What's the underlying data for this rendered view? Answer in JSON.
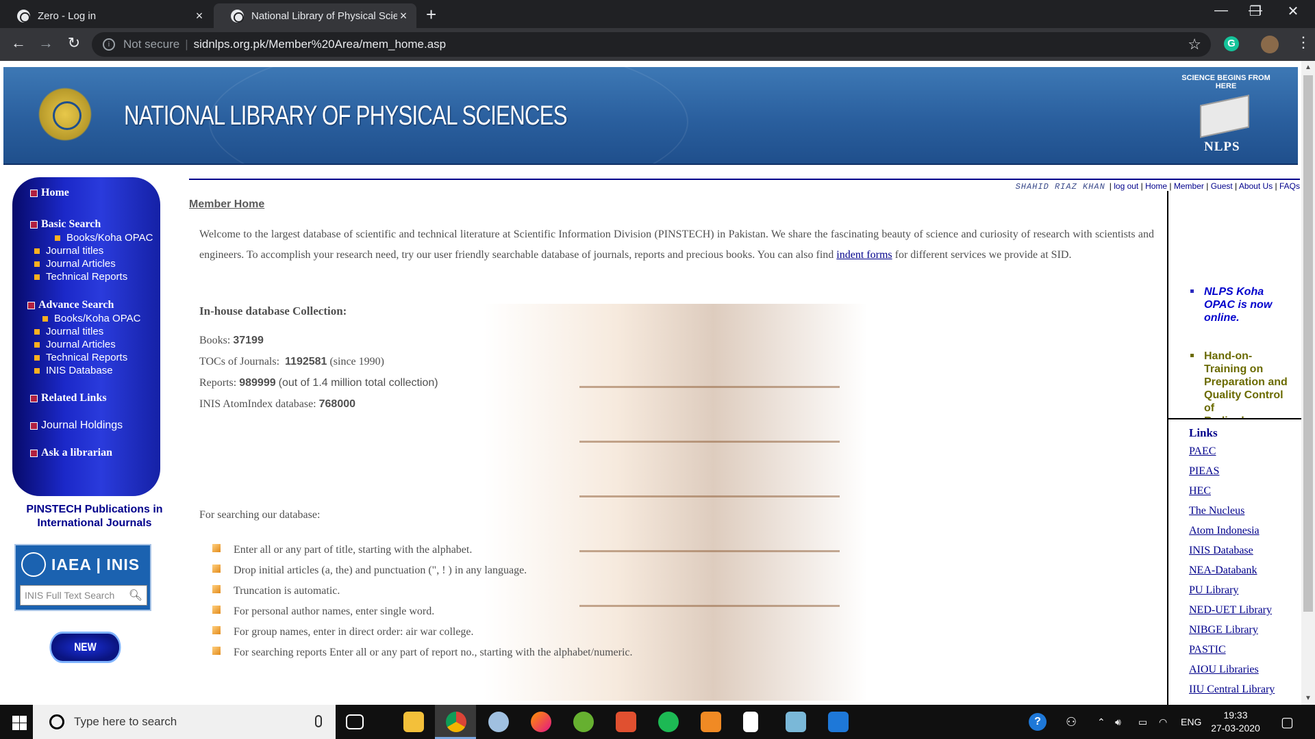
{
  "browser": {
    "tabs": [
      {
        "title": "Zero - Log in"
      },
      {
        "title": "National Library of Physical Scien"
      }
    ],
    "new_tab": "+",
    "controls": {
      "minimize": "—",
      "maximize": "❐",
      "close": "✕"
    },
    "nav": {
      "back": "←",
      "forward": "→",
      "reload": "↻"
    },
    "address": {
      "security": "Not secure",
      "separator": "|",
      "url": "sidnlps.org.pk/Member%20Area/mem_home.asp"
    },
    "extension_g": "G",
    "menu": "⋮"
  },
  "banner": {
    "title": "NATIONAL LIBRARY OF PHYSICAL SCIENCES",
    "tagline": "SCIENCE BEGINS FROM HERE",
    "logo_text": "NLPS"
  },
  "userbar": {
    "username": "SHAHID RIAZ KHAN",
    "links": [
      "log out",
      "Home",
      "Member",
      "Guest",
      "About Us",
      "FAQs"
    ]
  },
  "sidebar": {
    "home": "Home",
    "basic_search": {
      "label": "Basic Search",
      "items": [
        "Books/Koha OPAC",
        "Journal titles",
        "Journal Articles",
        "Technical Reports"
      ]
    },
    "advance_search": {
      "label": "Advance  Search",
      "items": [
        "Books/Koha OPAC",
        "Journal titles",
        "Journal Articles",
        "Technical Reports",
        "INIS Database"
      ]
    },
    "related_links": "Related Links",
    "journal_holdings": "Journal Holdings",
    "ask_librarian": "Ask a librarian",
    "publications": "PINSTECH Publications in International Journals",
    "inis": {
      "logo": "IAEA | INIS",
      "placeholder": "INIS Full Text Search"
    },
    "new_arrivals": "NEW ARRIVALS"
  },
  "content": {
    "heading": "Member Home",
    "welcome": "Welcome to the largest database of scientific and technical literature at Scientific Information Division (PINSTECH) in Pakistan. We share the fascinating beauty of science and curiosity of research with  scientists and engineers. To accomplish your research need, try our user friendly searchable database of journals, reports and precious books. You can also find",
    "indent_link": "indent forms",
    "welcome_end": "for different services we provide at SID.",
    "collection_heading": "In-house database Collection:",
    "stats": {
      "books_label": "Books:",
      "books_value": "37199",
      "tocs_label": "TOCs of Journals:",
      "tocs_value": "1192581",
      "tocs_note": "(since 1990)",
      "reports_label": "Reports:",
      "reports_value": "989999",
      "reports_note": "(out of 1.4 million total collection)",
      "inis_label": "INIS AtomIndex database:",
      "inis_value": "768000"
    },
    "searching_heading": "For searching our database:",
    "tips": [
      "Enter all or any part of title, starting with the alphabet.",
      "Drop initial articles (a, the) and punctuation (\", ! ) in any language.",
      "Truncation is automatic.",
      "For personal author names, enter single word.",
      "For group names, enter in direct order: air war college.",
      "For searching reports Enter all or any part of report no., starting with the alphabet/numeric."
    ]
  },
  "right": {
    "news": [
      {
        "text": "NLPS Koha OPAC is now online.",
        "color": "#0000cc"
      },
      {
        "text": "Hand-on-Training on Preparation and Quality Control of Radiopharmace",
        "color": "#6b6b00"
      }
    ],
    "links_heading": "Links",
    "links": [
      "PAEC",
      "PIEAS",
      "HEC",
      "The Nucleus",
      "Atom Indonesia",
      "INIS Database",
      "NEA-Databank",
      "PU Library",
      "NED-UET Library",
      "NIBGE Library",
      "PASTIC",
      "AIOU Libraries",
      "IIU Central Library"
    ]
  },
  "taskbar": {
    "search_placeholder": "Type here to search",
    "language": "ENG",
    "time": "19:33",
    "date": "27-03-2020"
  }
}
